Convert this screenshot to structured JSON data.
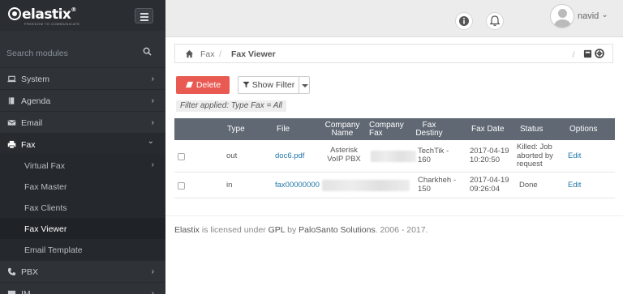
{
  "sidebar": {
    "logo": "elastix",
    "logo_reg": "®",
    "tagline": "FREEDOM TO COMMUNICATE",
    "search_placeholder": "Search modules",
    "items": [
      {
        "label": "System",
        "icon": "laptop-icon",
        "chevron": "›"
      },
      {
        "label": "Agenda",
        "icon": "book-icon",
        "chevron": "›"
      },
      {
        "label": "Email",
        "icon": "envelope-icon",
        "chevron": "›"
      },
      {
        "label": "Fax",
        "icon": "printer-icon",
        "chevron": "⌄"
      }
    ],
    "fax_subitems": [
      {
        "label": "Virtual Fax",
        "chevron": "›"
      },
      {
        "label": "Fax Master"
      },
      {
        "label": "Fax Clients"
      },
      {
        "label": "Fax Viewer"
      },
      {
        "label": "Email Template"
      }
    ],
    "after_items": [
      {
        "label": "PBX",
        "icon": "phone-icon",
        "chevron": "›"
      },
      {
        "label": "IM",
        "icon": "chat-icon",
        "chevron": "›"
      }
    ]
  },
  "topbar": {
    "username": "navid",
    "caret": "⌄"
  },
  "breadcrumb": {
    "section": "Fax",
    "separator": "/",
    "page": "Fax Viewer",
    "right_separator": "/"
  },
  "toolbar": {
    "delete_label": "Delete",
    "filter_label": "Show Filter",
    "filter_note": "Filter applied:  Type Fax = All"
  },
  "table": {
    "headers": {
      "type": "Type",
      "file": "File",
      "company_name_1": "Company",
      "company_name_2": "Name",
      "company_fax_1": "Company",
      "company_fax_2": "Fax",
      "fax_destiny_1": "Fax",
      "fax_destiny_2": "Destiny",
      "fax_date": "Fax Date",
      "status": "Status",
      "options": "Options"
    },
    "rows": [
      {
        "type": "out",
        "file": "doc6.pdf",
        "company_name_1": "Asterisk",
        "company_name_2": "VoIP PBX",
        "fax_destiny_1": "TechTik -",
        "fax_destiny_2": "160",
        "date_1": "2017-04-19",
        "date_2": "10:20:50",
        "status_1": "Killed: Job",
        "status_2": "aborted by",
        "status_3": "request",
        "option": "Edit"
      },
      {
        "type": "in",
        "file": "fax00000000",
        "fax_destiny_1": "Charkheh -",
        "fax_destiny_2": "150",
        "date_1": "2017-04-19",
        "date_2": "09:26:04",
        "status_1": "Done",
        "option": "Edit"
      }
    ]
  },
  "footer": {
    "brand": "Elastix",
    "text1": " is licensed under ",
    "license": "GPL",
    "text2": " by ",
    "company": "PaloSanto Solutions",
    "text3": ". 2006 - 2017."
  }
}
